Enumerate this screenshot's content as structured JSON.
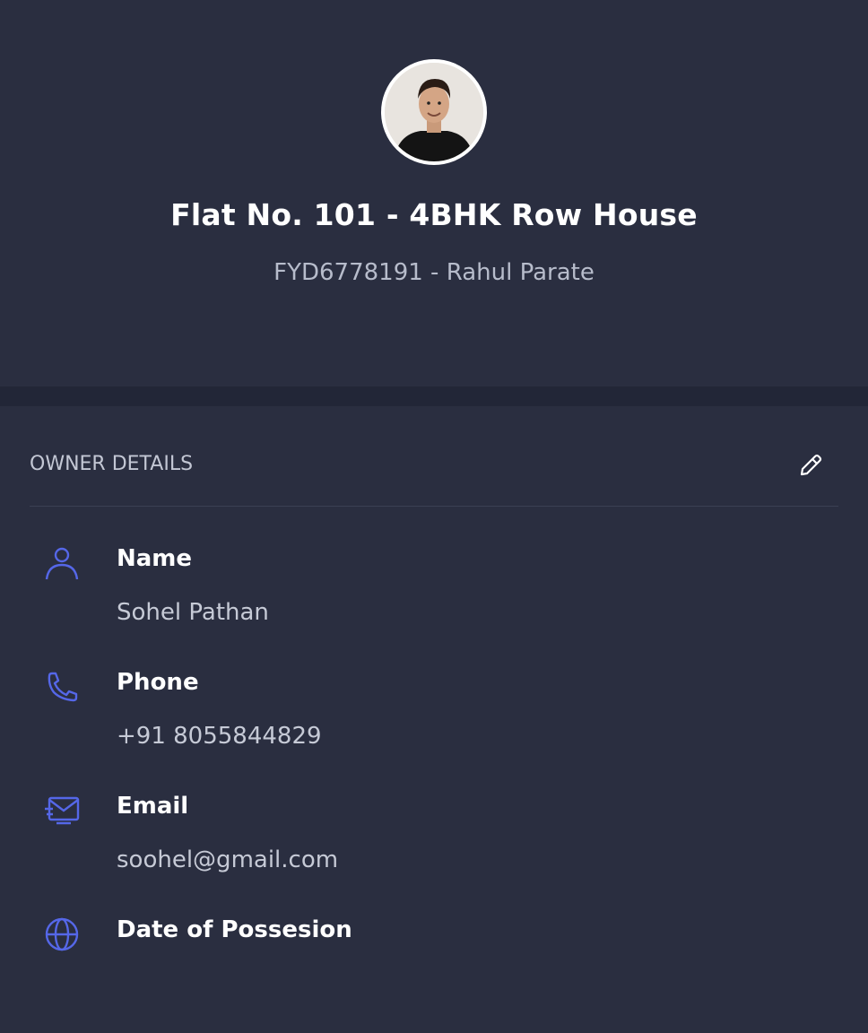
{
  "header": {
    "title": "Flat No. 101 - 4BHK Row House",
    "subtitle": "FYD6778191 - Rahul Parate",
    "avatar_icon": "profile-photo"
  },
  "owner_details": {
    "section_title": "OWNER DETAILS",
    "edit_icon": "pencil-icon",
    "rows": [
      {
        "icon": "user-icon",
        "label": "Name",
        "value": "Sohel Pathan"
      },
      {
        "icon": "phone-icon",
        "label": "Phone",
        "value": "+91 8055844829"
      },
      {
        "icon": "email-icon",
        "label": "Email",
        "value": "soohel@gmail.com"
      },
      {
        "icon": "globe-icon",
        "label": "Date of Possesion",
        "value": ""
      }
    ]
  },
  "colors": {
    "background": "#2a2e40",
    "separator": "#222637",
    "accent": "#5567e8",
    "text_primary": "#ffffff",
    "text_secondary": "#c6cad6"
  }
}
